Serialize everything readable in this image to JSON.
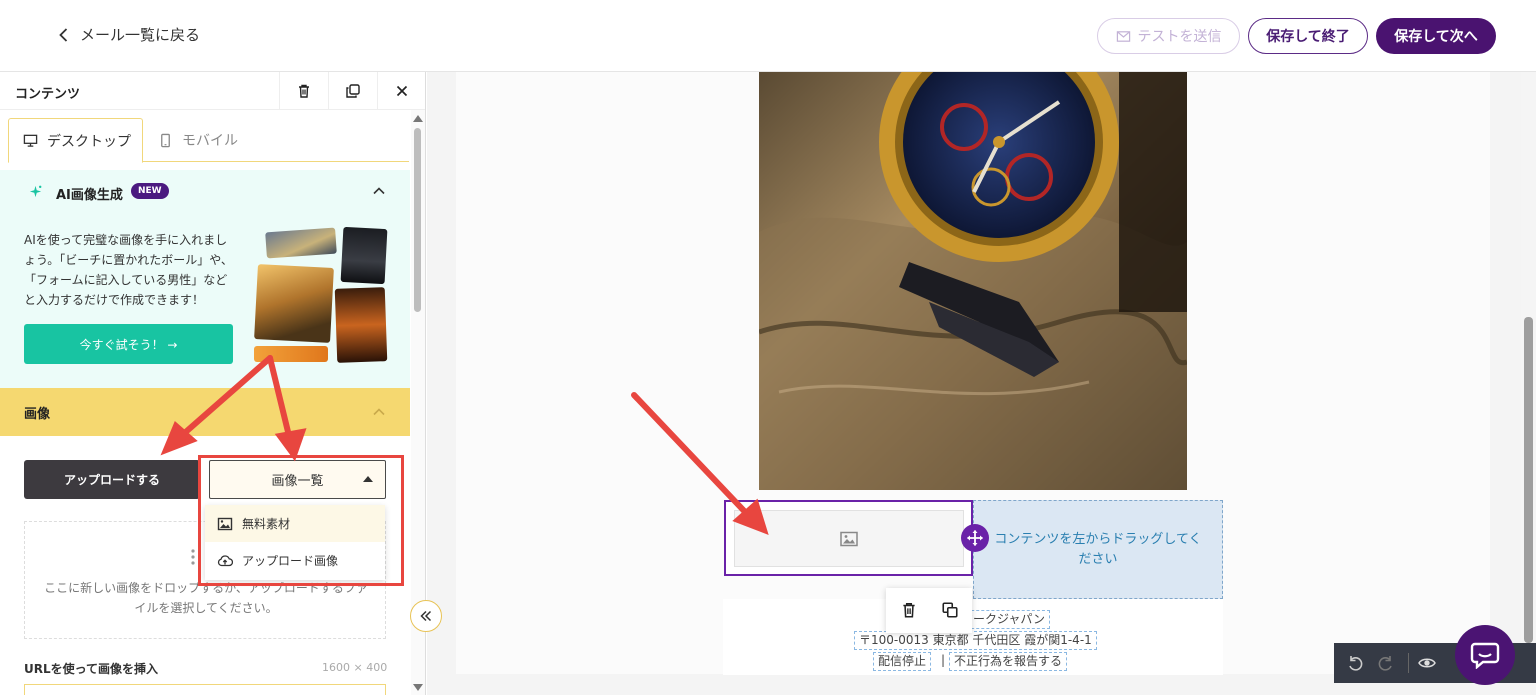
{
  "header": {
    "back_label": "メール一覧に戻る",
    "test_send_label": "テストを送信",
    "save_exit_label": "保存して終了",
    "save_next_label": "保存して次へ"
  },
  "panel": {
    "title": "コンテンツ",
    "tabs": [
      {
        "label": "デスクトップ",
        "icon": "desktop-icon",
        "active": true
      },
      {
        "label": "モバイル",
        "icon": "mobile-icon",
        "active": false
      }
    ],
    "ai": {
      "title": "AI画像生成",
      "badge": "NEW",
      "description": "AIを使って完璧な画像を手に入れましょう。「ビーチに置かれたボール」や、「フォームに記入している男性」などと入力するだけで作成できます！",
      "try_label": "今すぐ試そう！ →"
    },
    "image_section": {
      "title": "画像",
      "upload_label": "アップロードする",
      "list_select_label": "画像一覧",
      "menu_items": [
        {
          "label": "無料素材",
          "icon": "image-icon"
        },
        {
          "label": "アップロード画像",
          "icon": "cloud-upload-icon"
        }
      ],
      "drop_text": "ここに新しい画像をドロップするか、アップロードするファイルを選択してください。",
      "url_label": "URLを使って画像を挿入",
      "url_size": "1600 × 400"
    }
  },
  "canvas": {
    "drop_hint": "コンテンツを左からドラッグしてください",
    "footer": {
      "company": "マークジャパン",
      "address": "〒100-0013 東京都 千代田区 霞が関1-4-1",
      "unsubscribe": "配信停止",
      "separator": "|",
      "report": "不正行為を報告する"
    }
  },
  "colors": {
    "brand_purple": "#4a1370",
    "accent_yellow": "#f5d870",
    "ai_green": "#18c4a2",
    "annotation_red": "#e8463f"
  }
}
